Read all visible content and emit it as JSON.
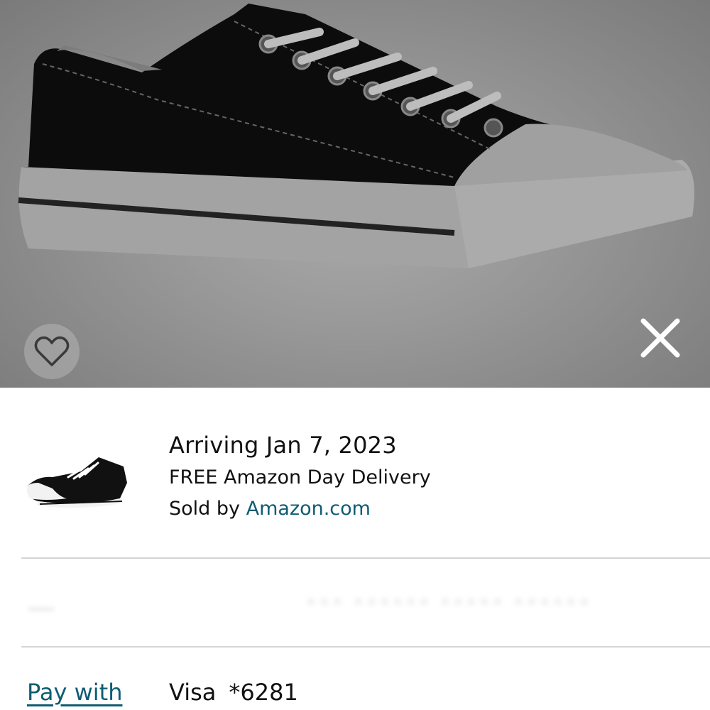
{
  "hero": {
    "image_icon": "sneaker-product-image",
    "favorite_icon": "heart-outline-icon",
    "close_icon": "close-x-icon"
  },
  "delivery": {
    "thumbnail_icon": "sneaker-thumbnail",
    "arriving": "Arriving Jan 7, 2023",
    "delivery_type": "FREE Amazon Day Delivery",
    "sold_by_prefix": "Sold by",
    "seller": "Amazon.com"
  },
  "blurred_section": {
    "text": "••• •••••• ••••• ••••••"
  },
  "payment": {
    "label": "Pay with",
    "card_brand": "Visa",
    "card_number": "*6281"
  },
  "colors": {
    "link": "#0f5c73",
    "divider": "#d5d5d5"
  }
}
